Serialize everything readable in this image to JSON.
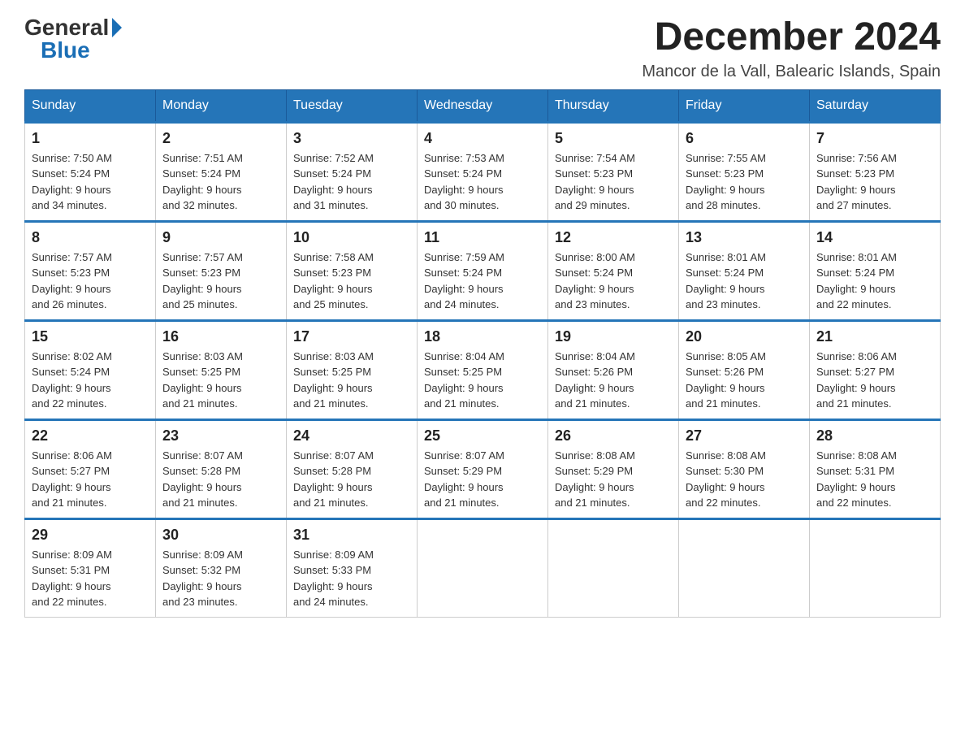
{
  "header": {
    "logo": {
      "general": "General",
      "blue": "Blue"
    },
    "month_year": "December 2024",
    "location": "Mancor de la Vall, Balearic Islands, Spain"
  },
  "days_of_week": [
    "Sunday",
    "Monday",
    "Tuesday",
    "Wednesday",
    "Thursday",
    "Friday",
    "Saturday"
  ],
  "weeks": [
    [
      {
        "day": "1",
        "sunrise": "7:50 AM",
        "sunset": "5:24 PM",
        "daylight": "9 hours and 34 minutes."
      },
      {
        "day": "2",
        "sunrise": "7:51 AM",
        "sunset": "5:24 PM",
        "daylight": "9 hours and 32 minutes."
      },
      {
        "day": "3",
        "sunrise": "7:52 AM",
        "sunset": "5:24 PM",
        "daylight": "9 hours and 31 minutes."
      },
      {
        "day": "4",
        "sunrise": "7:53 AM",
        "sunset": "5:24 PM",
        "daylight": "9 hours and 30 minutes."
      },
      {
        "day": "5",
        "sunrise": "7:54 AM",
        "sunset": "5:23 PM",
        "daylight": "9 hours and 29 minutes."
      },
      {
        "day": "6",
        "sunrise": "7:55 AM",
        "sunset": "5:23 PM",
        "daylight": "9 hours and 28 minutes."
      },
      {
        "day": "7",
        "sunrise": "7:56 AM",
        "sunset": "5:23 PM",
        "daylight": "9 hours and 27 minutes."
      }
    ],
    [
      {
        "day": "8",
        "sunrise": "7:57 AM",
        "sunset": "5:23 PM",
        "daylight": "9 hours and 26 minutes."
      },
      {
        "day": "9",
        "sunrise": "7:57 AM",
        "sunset": "5:23 PM",
        "daylight": "9 hours and 25 minutes."
      },
      {
        "day": "10",
        "sunrise": "7:58 AM",
        "sunset": "5:23 PM",
        "daylight": "9 hours and 25 minutes."
      },
      {
        "day": "11",
        "sunrise": "7:59 AM",
        "sunset": "5:24 PM",
        "daylight": "9 hours and 24 minutes."
      },
      {
        "day": "12",
        "sunrise": "8:00 AM",
        "sunset": "5:24 PM",
        "daylight": "9 hours and 23 minutes."
      },
      {
        "day": "13",
        "sunrise": "8:01 AM",
        "sunset": "5:24 PM",
        "daylight": "9 hours and 23 minutes."
      },
      {
        "day": "14",
        "sunrise": "8:01 AM",
        "sunset": "5:24 PM",
        "daylight": "9 hours and 22 minutes."
      }
    ],
    [
      {
        "day": "15",
        "sunrise": "8:02 AM",
        "sunset": "5:24 PM",
        "daylight": "9 hours and 22 minutes."
      },
      {
        "day": "16",
        "sunrise": "8:03 AM",
        "sunset": "5:25 PM",
        "daylight": "9 hours and 21 minutes."
      },
      {
        "day": "17",
        "sunrise": "8:03 AM",
        "sunset": "5:25 PM",
        "daylight": "9 hours and 21 minutes."
      },
      {
        "day": "18",
        "sunrise": "8:04 AM",
        "sunset": "5:25 PM",
        "daylight": "9 hours and 21 minutes."
      },
      {
        "day": "19",
        "sunrise": "8:04 AM",
        "sunset": "5:26 PM",
        "daylight": "9 hours and 21 minutes."
      },
      {
        "day": "20",
        "sunrise": "8:05 AM",
        "sunset": "5:26 PM",
        "daylight": "9 hours and 21 minutes."
      },
      {
        "day": "21",
        "sunrise": "8:06 AM",
        "sunset": "5:27 PM",
        "daylight": "9 hours and 21 minutes."
      }
    ],
    [
      {
        "day": "22",
        "sunrise": "8:06 AM",
        "sunset": "5:27 PM",
        "daylight": "9 hours and 21 minutes."
      },
      {
        "day": "23",
        "sunrise": "8:07 AM",
        "sunset": "5:28 PM",
        "daylight": "9 hours and 21 minutes."
      },
      {
        "day": "24",
        "sunrise": "8:07 AM",
        "sunset": "5:28 PM",
        "daylight": "9 hours and 21 minutes."
      },
      {
        "day": "25",
        "sunrise": "8:07 AM",
        "sunset": "5:29 PM",
        "daylight": "9 hours and 21 minutes."
      },
      {
        "day": "26",
        "sunrise": "8:08 AM",
        "sunset": "5:29 PM",
        "daylight": "9 hours and 21 minutes."
      },
      {
        "day": "27",
        "sunrise": "8:08 AM",
        "sunset": "5:30 PM",
        "daylight": "9 hours and 22 minutes."
      },
      {
        "day": "28",
        "sunrise": "8:08 AM",
        "sunset": "5:31 PM",
        "daylight": "9 hours and 22 minutes."
      }
    ],
    [
      {
        "day": "29",
        "sunrise": "8:09 AM",
        "sunset": "5:31 PM",
        "daylight": "9 hours and 22 minutes."
      },
      {
        "day": "30",
        "sunrise": "8:09 AM",
        "sunset": "5:32 PM",
        "daylight": "9 hours and 23 minutes."
      },
      {
        "day": "31",
        "sunrise": "8:09 AM",
        "sunset": "5:33 PM",
        "daylight": "9 hours and 24 minutes."
      },
      null,
      null,
      null,
      null
    ]
  ],
  "labels": {
    "sunrise": "Sunrise:",
    "sunset": "Sunset:",
    "daylight": "Daylight:"
  }
}
